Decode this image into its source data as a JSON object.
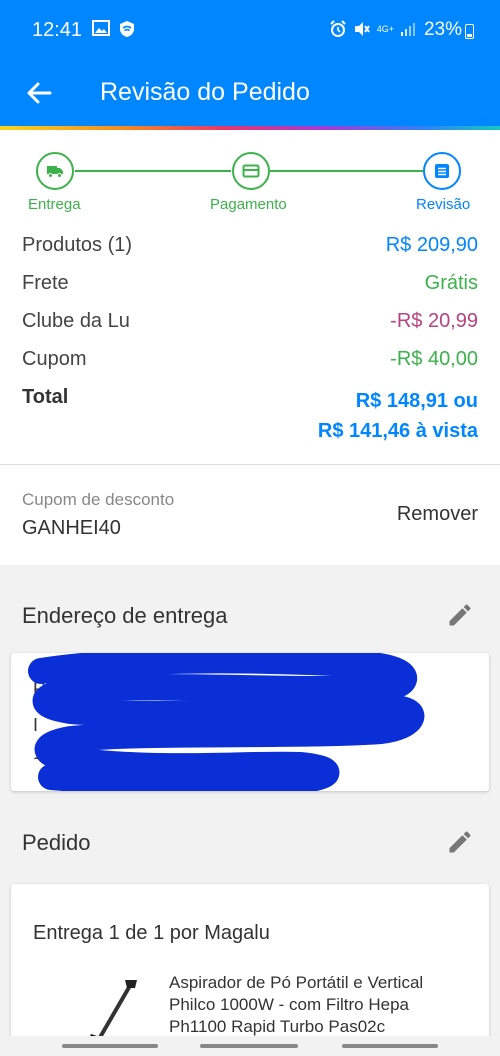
{
  "status_bar": {
    "time": "12:41",
    "network": "4G+",
    "battery": "23%",
    "icons": [
      "image-icon",
      "shield-icon",
      "alarm-icon",
      "mute-icon",
      "signal-icon",
      "battery-icon"
    ]
  },
  "app_bar": {
    "title": "Revisão do Pedido",
    "back_icon": "arrow-left-icon"
  },
  "stepper": {
    "steps": [
      {
        "label": "Entrega",
        "icon": "truck-icon",
        "state": "done"
      },
      {
        "label": "Pagamento",
        "icon": "card-icon",
        "state": "done"
      },
      {
        "label": "Revisão",
        "icon": "list-icon",
        "state": "current"
      }
    ]
  },
  "summary": {
    "rows": [
      {
        "label": "Produtos (1)",
        "value": "R$ 209,90",
        "color": "#0086ff"
      },
      {
        "label": "Frete",
        "value": "Grátis",
        "color": "#3cb24a"
      },
      {
        "label": "Clube da Lu",
        "value": "-R$ 20,99",
        "color": "#b8427d"
      },
      {
        "label": "Cupom",
        "value": "-R$ 40,00",
        "color": "#3cb24a"
      }
    ],
    "total": {
      "label": "Total",
      "value_line1": "R$ 148,91 ou",
      "value_line2": "R$ 141,46 à vista"
    }
  },
  "coupon": {
    "label": "Cupom de desconto",
    "code": "GANHEI40",
    "remove_label": "Remover"
  },
  "address_section": {
    "title": "Endereço de entrega",
    "lines": [
      "R",
      "I",
      "1"
    ]
  },
  "order_section": {
    "title": "Pedido",
    "delivery": "Entrega 1 de 1 por Magalu",
    "product_name": "Aspirador de Pó Portátil e Vertical Philco 1000W - com Filtro Hepa Ph1100 Rapid Turbo Pas02c"
  },
  "colors": {
    "primary": "#0086ff",
    "success": "#3cb24a",
    "club": "#b8427d"
  }
}
